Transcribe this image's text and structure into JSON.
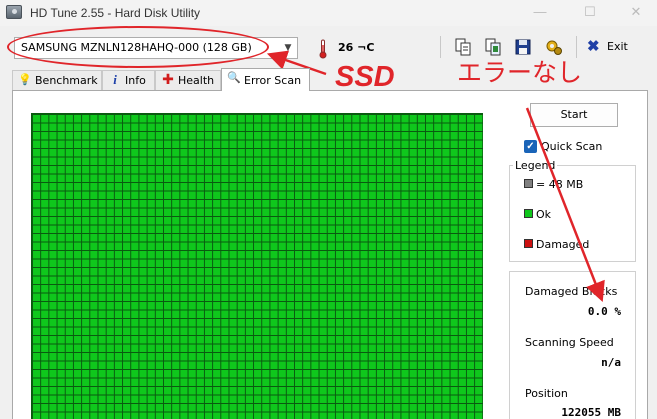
{
  "window": {
    "title": "HD Tune 2.55 - Hard Disk Utility",
    "controls": {
      "minimize": "—",
      "maximize": "☐",
      "close": "✕"
    }
  },
  "toolbar": {
    "drive_value": "SAMSUNG MZNLN128HAHQ-000 (128 GB)",
    "temperature": "26 ¬C",
    "buttons": [
      "copy-text-icon",
      "copy-screenshot-icon",
      "save-icon",
      "options-icon"
    ],
    "exit_label": "Exit"
  },
  "tabs": [
    {
      "label": "Benchmark",
      "icon": "benchmark-icon",
      "active": false
    },
    {
      "label": "Info",
      "icon": "info-icon",
      "active": false
    },
    {
      "label": "Health",
      "icon": "health-icon",
      "active": false
    },
    {
      "label": "Error Scan",
      "icon": "magnifier-icon",
      "active": true
    }
  ],
  "scan": {
    "start_label": "Start",
    "quick_scan_label": "Quick Scan",
    "quick_scan_checked": true,
    "legend_title": "Legend",
    "legend": [
      {
        "label": "= 48 MB",
        "color": "#808080"
      },
      {
        "label": "Ok",
        "color": "#0fc71c"
      },
      {
        "label": "Damaged",
        "color": "#cc1111"
      }
    ],
    "damaged_blocks_label": "Damaged Blocks",
    "damaged_blocks_value": "0.0 %",
    "scanning_speed_label": "Scanning Speed",
    "scanning_speed_value": "n/a",
    "position_label": "Position",
    "position_value": "122055 MB"
  },
  "annotations": {
    "ssd_text": "SSD",
    "no_error_text": "エラーなし",
    "color": "#e0252a"
  }
}
